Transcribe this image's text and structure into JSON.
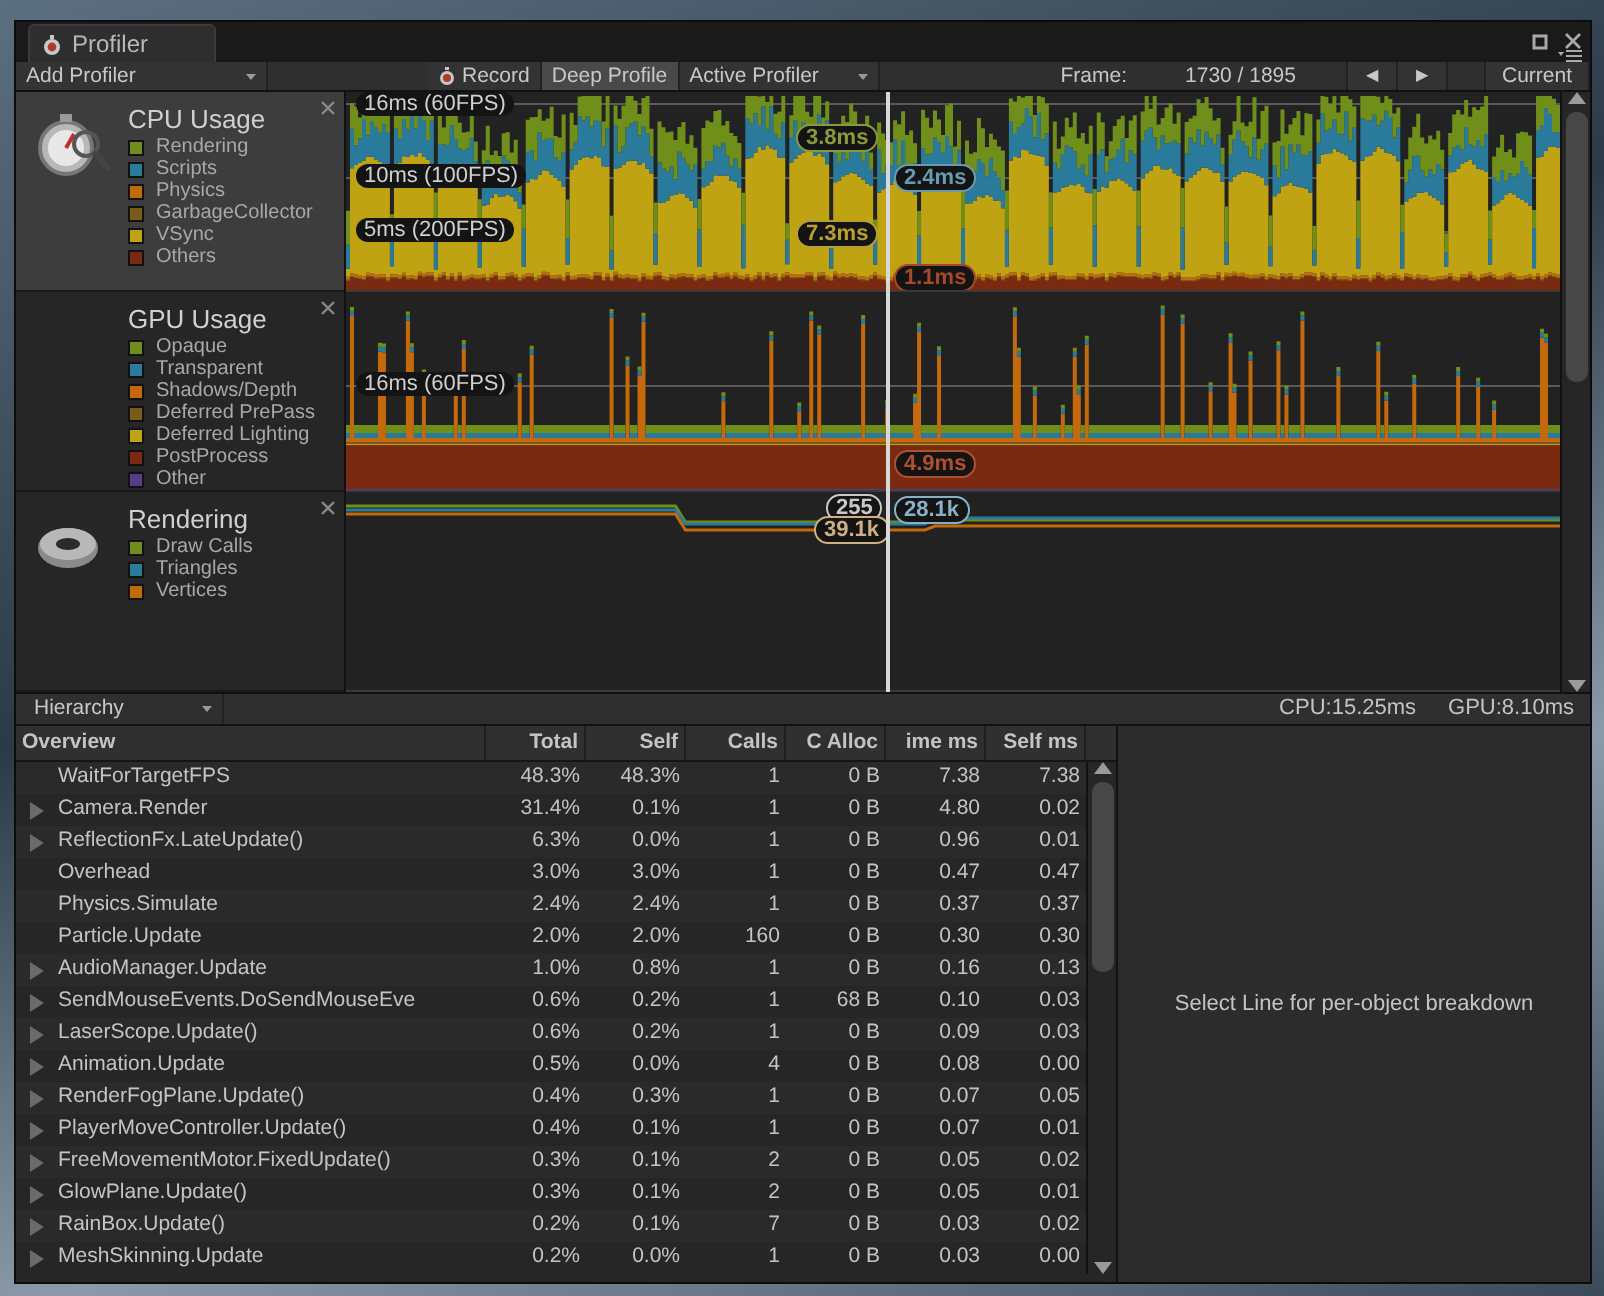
{
  "window": {
    "tab_title": "Profiler"
  },
  "toolbar": {
    "add_profiler": "Add Profiler",
    "record": "Record",
    "deep_profile": "Deep Profile",
    "active_profiler": "Active Profiler",
    "frame_label": "Frame:",
    "frame_value": "1730 / 1895",
    "prev": "◀",
    "next": "▶",
    "current": "Current"
  },
  "profilers": [
    {
      "kind": "cpu",
      "title": "CPU Usage",
      "selected": true,
      "legend": [
        {
          "label": "Rendering",
          "color": "#6f8f1a"
        },
        {
          "label": "Scripts",
          "color": "#2a7a9c"
        },
        {
          "label": "Physics",
          "color": "#c46a0c"
        },
        {
          "label": "GarbageCollector",
          "color": "#7a5a18"
        },
        {
          "label": "VSync",
          "color": "#c0a312"
        },
        {
          "label": "Others",
          "color": "#7a2a10"
        }
      ],
      "guides": [
        "16ms (60FPS)",
        "10ms (100FPS)",
        "5ms (200FPS)"
      ],
      "readings": [
        {
          "text": "3.8ms",
          "color": "#8a9a3a"
        },
        {
          "text": "2.4ms",
          "color": "#6a9ab0"
        },
        {
          "text": "7.3ms",
          "color": "#b8a030"
        },
        {
          "text": "1.1ms",
          "color": "#a8482a"
        }
      ]
    },
    {
      "kind": "gpu",
      "title": "GPU Usage",
      "selected": false,
      "legend": [
        {
          "label": "Opaque",
          "color": "#6f8f1a"
        },
        {
          "label": "Transparent",
          "color": "#2a7a9c"
        },
        {
          "label": "Shadows/Depth",
          "color": "#c46a0c"
        },
        {
          "label": "Deferred PrePass",
          "color": "#7a5a18"
        },
        {
          "label": "Deferred Lighting",
          "color": "#c0a312"
        },
        {
          "label": "PostProcess",
          "color": "#7a2a10"
        },
        {
          "label": "Other",
          "color": "#5a3a8a"
        }
      ],
      "guides": [
        "16ms (60FPS)"
      ],
      "readings": [
        {
          "text": "4.9ms",
          "color": "#b0502e"
        }
      ]
    },
    {
      "kind": "rendering",
      "title": "Rendering",
      "selected": false,
      "legend": [
        {
          "label": "Draw Calls",
          "color": "#6f8f1a"
        },
        {
          "label": "Triangles",
          "color": "#2a7a9c"
        },
        {
          "label": "Vertices",
          "color": "#c46a0c"
        }
      ],
      "readings": [
        {
          "text": "255",
          "color": "#c8c8c8"
        },
        {
          "text": "28.1k",
          "color": "#8ab0c8"
        },
        {
          "text": "39.1k",
          "color": "#d0b080"
        }
      ]
    }
  ],
  "status_bar": {
    "view": "Hierarchy",
    "cpu": "CPU:15.25ms",
    "gpu": "GPU:8.10ms"
  },
  "table": {
    "columns": [
      "Overview",
      "Total",
      "Self",
      "Calls",
      "C Alloc",
      "ime ms",
      "Self ms"
    ],
    "rows": [
      {
        "kind": "leaf",
        "name": "WaitForTargetFPS",
        "total": "48.3%",
        "self": "48.3%",
        "calls": "1",
        "gc": "0 B",
        "time": "7.38",
        "self_ms": "7.38"
      },
      {
        "kind": "group",
        "name": "Camera.Render",
        "total": "31.4%",
        "self": "0.1%",
        "calls": "1",
        "gc": "0 B",
        "time": "4.80",
        "self_ms": "0.02"
      },
      {
        "kind": "group",
        "name": "ReflectionFx.LateUpdate()",
        "total": "6.3%",
        "self": "0.0%",
        "calls": "1",
        "gc": "0 B",
        "time": "0.96",
        "self_ms": "0.01"
      },
      {
        "kind": "leaf",
        "name": "Overhead",
        "total": "3.0%",
        "self": "3.0%",
        "calls": "1",
        "gc": "0 B",
        "time": "0.47",
        "self_ms": "0.47"
      },
      {
        "kind": "leaf",
        "name": "Physics.Simulate",
        "total": "2.4%",
        "self": "2.4%",
        "calls": "1",
        "gc": "0 B",
        "time": "0.37",
        "self_ms": "0.37"
      },
      {
        "kind": "leaf",
        "name": "Particle.Update",
        "total": "2.0%",
        "self": "2.0%",
        "calls": "160",
        "gc": "0 B",
        "time": "0.30",
        "self_ms": "0.30"
      },
      {
        "kind": "group",
        "name": "AudioManager.Update",
        "total": "1.0%",
        "self": "0.8%",
        "calls": "1",
        "gc": "0 B",
        "time": "0.16",
        "self_ms": "0.13"
      },
      {
        "kind": "group",
        "name": "SendMouseEvents.DoSendMouseEve",
        "total": "0.6%",
        "self": "0.2%",
        "calls": "1",
        "gc": "68 B",
        "time": "0.10",
        "self_ms": "0.03"
      },
      {
        "kind": "group",
        "name": "LaserScope.Update()",
        "total": "0.6%",
        "self": "0.2%",
        "calls": "1",
        "gc": "0 B",
        "time": "0.09",
        "self_ms": "0.03"
      },
      {
        "kind": "group",
        "name": "Animation.Update",
        "total": "0.5%",
        "self": "0.0%",
        "calls": "4",
        "gc": "0 B",
        "time": "0.08",
        "self_ms": "0.00"
      },
      {
        "kind": "group",
        "name": "RenderFogPlane.Update()",
        "total": "0.4%",
        "self": "0.3%",
        "calls": "1",
        "gc": "0 B",
        "time": "0.07",
        "self_ms": "0.05"
      },
      {
        "kind": "group",
        "name": "PlayerMoveController.Update()",
        "total": "0.4%",
        "self": "0.1%",
        "calls": "1",
        "gc": "0 B",
        "time": "0.07",
        "self_ms": "0.01"
      },
      {
        "kind": "group",
        "name": "FreeMovementMotor.FixedUpdate()",
        "total": "0.3%",
        "self": "0.1%",
        "calls": "2",
        "gc": "0 B",
        "time": "0.05",
        "self_ms": "0.02"
      },
      {
        "kind": "group",
        "name": "GlowPlane.Update()",
        "total": "0.3%",
        "self": "0.1%",
        "calls": "2",
        "gc": "0 B",
        "time": "0.05",
        "self_ms": "0.01"
      },
      {
        "kind": "group",
        "name": "RainBox.Update()",
        "total": "0.2%",
        "self": "0.1%",
        "calls": "7",
        "gc": "0 B",
        "time": "0.03",
        "self_ms": "0.02"
      },
      {
        "kind": "group",
        "name": "MeshSkinning.Update",
        "total": "0.2%",
        "self": "0.0%",
        "calls": "1",
        "gc": "0 B",
        "time": "0.03",
        "self_ms": "0.00"
      }
    ]
  },
  "detail_pane": {
    "message": "Select Line for per-object breakdown"
  }
}
